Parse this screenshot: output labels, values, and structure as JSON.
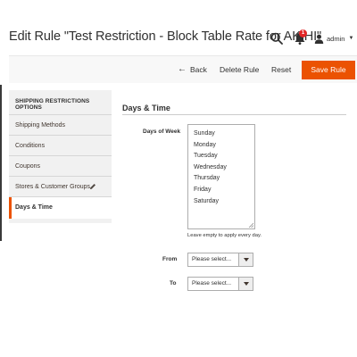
{
  "header": {
    "title": "Edit Rule \"Test Restriction - Block Table Rate for AK/HI\"",
    "search_icon": "search-icon",
    "notifications": {
      "icon": "bell-icon",
      "count": "1"
    },
    "user": {
      "icon": "user-icon",
      "name": "admin",
      "caret": "▼"
    }
  },
  "actions": {
    "back": {
      "arrow": "←",
      "label": "Back"
    },
    "delete": "Delete Rule",
    "reset": "Reset",
    "save": "Save Rule"
  },
  "sidebar": {
    "heading": "SHIPPING RESTRICTIONS OPTIONS",
    "items": [
      {
        "label": "Shipping Methods"
      },
      {
        "label": "Conditions"
      },
      {
        "label": "Coupons"
      },
      {
        "label": "Stores & Customer Groups",
        "icon": "pencil-icon"
      },
      {
        "label": "Days & Time",
        "active": true
      }
    ]
  },
  "main": {
    "section_title": "Days & Time",
    "days_of_week": {
      "label": "Days of Week",
      "options": [
        "Sunday",
        "Monday",
        "Tuesday",
        "Wednesday",
        "Thursday",
        "Friday",
        "Saturday"
      ],
      "hint": "Leave empty to apply every day."
    },
    "from": {
      "label": "From",
      "value": "Please select..."
    },
    "to": {
      "label": "To",
      "value": "Please select..."
    }
  },
  "colors": {
    "accent": "#eb5202",
    "badge": "#e22626",
    "sidebar_bg": "#f1f1f1",
    "action_bar_bg": "#f8f8f8"
  }
}
